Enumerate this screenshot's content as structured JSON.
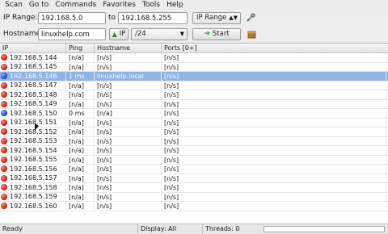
{
  "menubar": [
    "Scan",
    "Go to",
    "Commands",
    "Favorites",
    "Tools",
    "Help"
  ],
  "toolbar": {
    "ip_range_label": "IP Range:",
    "range_start": "192.168.5.0",
    "to_label": "to",
    "range_end": "192.168.5.255",
    "feeder": "IP Range",
    "hostname_label": "Hostname:",
    "hostname": "linuxhelp.com",
    "ip_button": "IP",
    "netmask": "/24",
    "start_button": "Start"
  },
  "columns": [
    "IP",
    "Ping",
    "Hostname",
    "Ports [0+]"
  ],
  "rows": [
    {
      "ip": "192.168.5.144",
      "ping": "[n/a]",
      "host": "[n/s]",
      "ports": "[n/s]",
      "alive": false
    },
    {
      "ip": "192.168.5.145",
      "ping": "[n/a]",
      "host": "[n/s]",
      "ports": "[n/s]",
      "alive": false
    },
    {
      "ip": "192.168.5.146",
      "ping": "1 ms",
      "host": "linuxhelp.local",
      "ports": "[n/s]",
      "alive": true,
      "selected": true
    },
    {
      "ip": "192.168.5.147",
      "ping": "[n/a]",
      "host": "[n/s]",
      "ports": "[n/s]",
      "alive": false
    },
    {
      "ip": "192.168.5.148",
      "ping": "[n/a]",
      "host": "[n/s]",
      "ports": "[n/s]",
      "alive": false
    },
    {
      "ip": "192.168.5.149",
      "ping": "[n/a]",
      "host": "[n/s]",
      "ports": "[n/s]",
      "alive": false
    },
    {
      "ip": "192.168.5.150",
      "ping": "0 ms",
      "host": "[n/a]",
      "ports": "[n/s]",
      "alive": true
    },
    {
      "ip": "192.168.5.151",
      "ping": "[n/a]",
      "host": "[n/s]",
      "ports": "[n/s]",
      "alive": false
    },
    {
      "ip": "192.168.5.152",
      "ping": "[n/a]",
      "host": "[n/s]",
      "ports": "[n/s]",
      "alive": false
    },
    {
      "ip": "192.168.5.153",
      "ping": "[n/a]",
      "host": "[n/s]",
      "ports": "[n/s]",
      "alive": false
    },
    {
      "ip": "192.168.5.154",
      "ping": "[n/a]",
      "host": "[n/s]",
      "ports": "[n/s]",
      "alive": false
    },
    {
      "ip": "192.168.5.155",
      "ping": "[n/a]",
      "host": "[n/s]",
      "ports": "[n/s]",
      "alive": false
    },
    {
      "ip": "192.168.5.156",
      "ping": "[n/a]",
      "host": "[n/s]",
      "ports": "[n/s]",
      "alive": false
    },
    {
      "ip": "192.168.5.157",
      "ping": "[n/a]",
      "host": "[n/s]",
      "ports": "[n/s]",
      "alive": false
    },
    {
      "ip": "192.168.5.158",
      "ping": "[n/a]",
      "host": "[n/s]",
      "ports": "[n/s]",
      "alive": false
    },
    {
      "ip": "192.168.5.159",
      "ping": "[n/a]",
      "host": "[n/s]",
      "ports": "[n/s]",
      "alive": false
    },
    {
      "ip": "192.168.5.160",
      "ping": "[n/a]",
      "host": "[n/s]",
      "ports": "[n/s]",
      "alive": false
    }
  ],
  "status": {
    "state": "Ready",
    "display": "Display: All",
    "threads": "Threads: 0",
    "progress": 0
  },
  "icons": {
    "dead_host": "red-dot-icon",
    "alive_host": "blue-dot-icon",
    "preferences": "wrench-icon",
    "fetchers": "box-icon",
    "ip_button": "up-arrow-icon",
    "start_button": "play-arrow-icon"
  },
  "colors": {
    "dead": "#d0210f",
    "alive": "#2244c8",
    "selection": "#8fb3e3"
  }
}
